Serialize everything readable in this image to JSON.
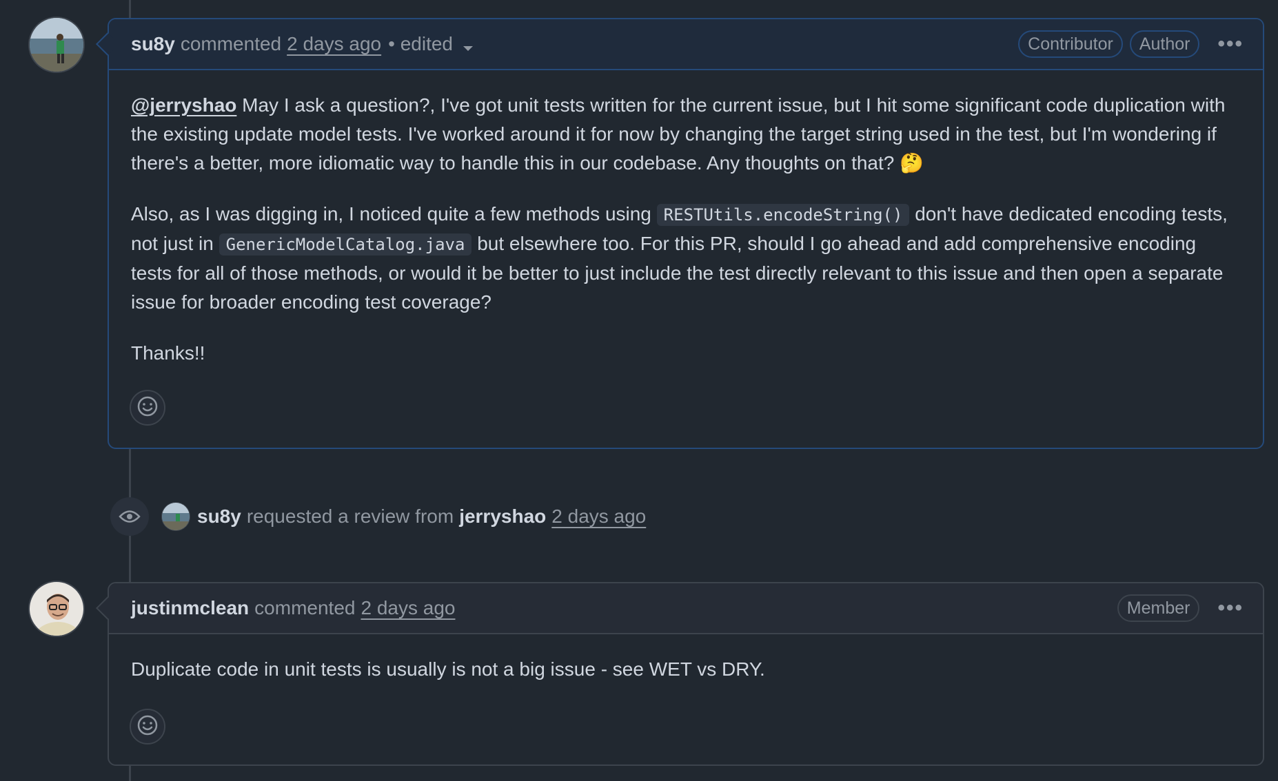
{
  "comment1": {
    "author": "su8y",
    "action": "commented",
    "time": "2 days ago",
    "edited": "• edited",
    "badges": [
      "Contributor",
      "Author"
    ],
    "more": "•••",
    "mention": "@jerryshao",
    "para1_rest": " May I ask a question?, I've got unit tests written for the current issue, but I hit some significant code duplication with the existing update model tests. I've worked around it for now by changing the target string used in the test, but I'm wondering if there's a better, more idiomatic way to handle this in our codebase. Any thoughts on that? 🤔",
    "para2_a": "Also, as I was digging in, I noticed quite a few methods using ",
    "para2_code1": "RESTUtils.encodeString()",
    "para2_b": " don't have dedicated encoding tests, not just in ",
    "para2_code2": "GenericModelCatalog.java",
    "para2_c": " but elsewhere too. For this PR, should I go ahead and add comprehensive encoding tests for all of those methods, or would it be better to just include the test directly relevant to this issue and then open a separate issue for broader encoding test coverage?",
    "para3": "Thanks!!"
  },
  "event": {
    "actor": "su8y",
    "text": "requested a review from",
    "target": "jerryshao",
    "time": "2 days ago"
  },
  "comment2": {
    "author": "justinmclean",
    "action": "commented",
    "time": "2 days ago",
    "badge": "Member",
    "more": "•••",
    "body": "Duplicate code in unit tests is usually is not a big issue - see WET vs DRY."
  },
  "colors": {
    "background": "#212830",
    "border": "#3d444d",
    "own_border": "#254a7a",
    "text": "#d1d7e0",
    "muted": "#9198a1"
  }
}
